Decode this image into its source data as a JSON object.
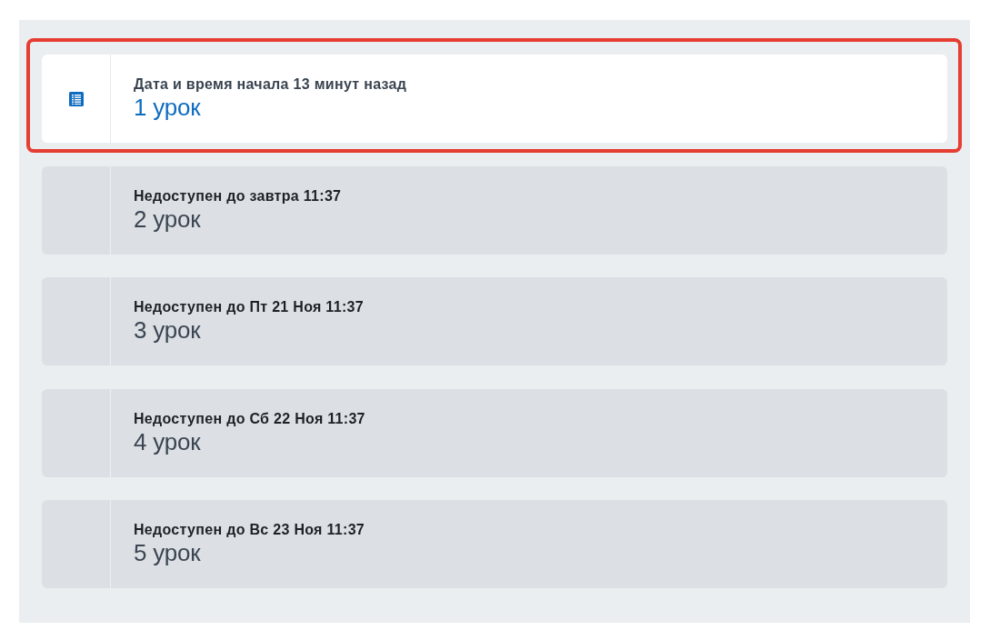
{
  "lessons": [
    {
      "status": "Дата и время начала 13 минут назад",
      "title": "1 урок",
      "available": true,
      "highlighted": true
    },
    {
      "status": "Недоступен до завтра 11:37",
      "title": "2 урок",
      "available": false,
      "highlighted": false
    },
    {
      "status": "Недоступен до Пт 21 Ноя 11:37",
      "title": "3 урок",
      "available": false,
      "highlighted": false
    },
    {
      "status": "Недоступен до Сб 22 Ноя 11:37",
      "title": "4 урок",
      "available": false,
      "highlighted": false
    },
    {
      "status": "Недоступен до Вс 23 Ноя 11:37",
      "title": "5 урок",
      "available": false,
      "highlighted": false
    }
  ]
}
